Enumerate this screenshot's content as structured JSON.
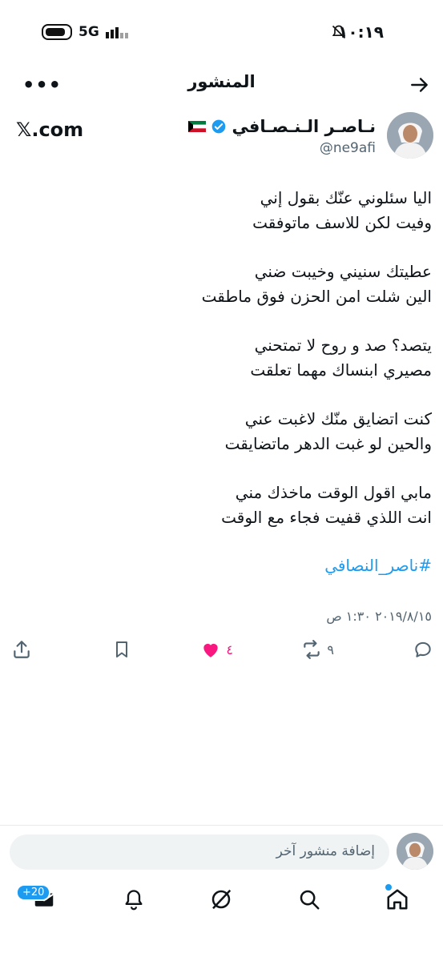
{
  "status_bar": {
    "time": "١٠:١٩",
    "network": "5G"
  },
  "header": {
    "title": "المنشور",
    "more_icon": "more-horizontal-icon",
    "back_icon": "arrow-right-icon"
  },
  "post": {
    "author_name": "نـاصـر الـنـصـافي",
    "handle": "@ne9afi",
    "source_label": "𝕏.com",
    "verified_icon": "verified-badge-icon",
    "flag_icon": "kuwait-flag-icon",
    "stanzas": [
      [
        "اليا سئلوني عنّك بقول إني",
        "وفيت لكن للاسف ماتوفقت"
      ],
      [
        "عطيتك سنيني وخيبت ضني",
        "الين شلت امن الحزن فوق ماطقت"
      ],
      [
        "يتصد؟ صد و روح لا تمتحني",
        "مصيري ابنساك مهما تعلقت"
      ],
      [
        "كنت اتضايق منّك لاغبت عني",
        "والحين لو غبت الدهر ماتضايقت"
      ],
      [
        "مابي اقول الوقت ماخذك مني",
        "انت اللذي قفيت فجاء مع الوقت"
      ]
    ],
    "hashtag": "#ناصر_النصافي",
    "timestamp": "٢٠١٩/٨/١٥ ١:٣٠ ص"
  },
  "actions": {
    "replies_icon": "reply-icon",
    "reposts_count": "٩",
    "likes_count": "٤",
    "like_color": "#f91880",
    "bookmark_icon": "bookmark-icon",
    "share_icon": "share-icon"
  },
  "composer": {
    "placeholder": "إضافة منشور آخر"
  },
  "bottom_nav": {
    "messages_badge": "+20",
    "accent": "#1d9bf0"
  }
}
